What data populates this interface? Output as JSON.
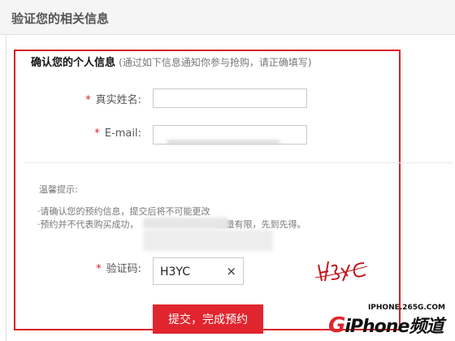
{
  "header": {
    "title": "验证您的相关信息"
  },
  "section": {
    "title": "确认您的个人信息",
    "hint": "(通过如下信息通知你参与抢购，请正确填写)"
  },
  "fields": {
    "name": {
      "required_mark": "*",
      "label": "真实姓名:",
      "value": ""
    },
    "email": {
      "required_mark": "*",
      "label": "E-mail:",
      "value": ""
    }
  },
  "tips": {
    "title": "温馨提示:",
    "line1": "·请确认您的预约信息，提交后将不可能更改",
    "line2": "·预约并不代表购买成功，",
    "line2_end": "数量有限，先到先得。"
  },
  "captcha": {
    "required_mark": "*",
    "label": "验证码:",
    "value": "H3YC",
    "clear_symbol": "×",
    "image_text": "H3YC"
  },
  "submit": {
    "label": "提交，完成预约"
  },
  "watermark": {
    "site": "IPHONE.265G.COM",
    "brand_prefix": "G",
    "brand": "iPhone频道"
  },
  "colors": {
    "accent": "#e1252e",
    "border": "#d71f2a"
  }
}
